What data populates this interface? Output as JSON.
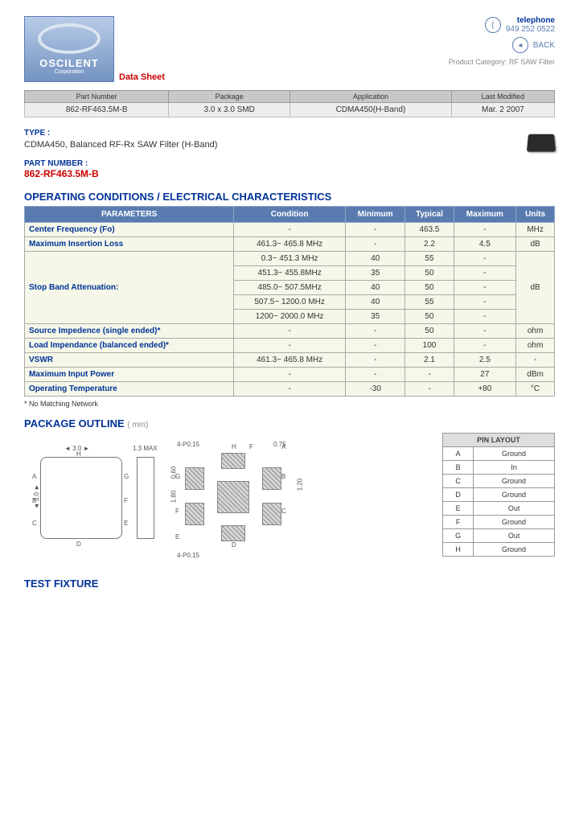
{
  "header": {
    "logo_name": "OSCILENT",
    "logo_sub": "Corporation",
    "datasheet_label": "Data Sheet",
    "telephone_label": "telephone",
    "telephone": "949 252 0522",
    "back": "BACK",
    "product_category_label": "Product Category:",
    "product_category": "RF SAW Filter"
  },
  "info": {
    "headers": [
      "Part Number",
      "Package",
      "Application",
      "Last Modified"
    ],
    "values": [
      "862-RF463.5M-B",
      "3.0 x 3.0 SMD",
      "CDMA450(H-Band)",
      "Mar. 2 2007"
    ]
  },
  "type_label": "TYPE :",
  "type_value": "CDMA450, Balanced RF-Rx SAW Filter (H-Band)",
  "pn_label": "PART NUMBER :",
  "pn_value": "862-RF463.5M-B",
  "char_heading": "OPERATING CONDITIONS / ELECTRICAL CHARACTERISTICS",
  "char_headers": [
    "PARAMETERS",
    "Condition",
    "Minimum",
    "Typical",
    "Maximum",
    "Units"
  ],
  "char_rows": [
    {
      "p": "Center Frequency (Fo)",
      "c": "-",
      "min": "-",
      "typ": "463.5",
      "max": "-",
      "u": "MHz",
      "rs": 1
    },
    {
      "p": "Maximum Insertion Loss",
      "c": "461.3~ 465.8 MHz",
      "min": "-",
      "typ": "2.2",
      "max": "4.5",
      "u": "dB",
      "rs": 1
    },
    {
      "p": "Stop Band Attenuation:",
      "c": "0.3~ 451.3 MHz",
      "min": "40",
      "typ": "55",
      "max": "-",
      "u": "dB",
      "rs": 5,
      "first": true
    },
    {
      "c": "451.3~ 455.8MHz",
      "min": "35",
      "typ": "50",
      "max": "-"
    },
    {
      "c": "485.0~ 507.5MHz",
      "min": "40",
      "typ": "50",
      "max": "-"
    },
    {
      "c": "507.5~ 1200.0 MHz",
      "min": "40",
      "typ": "55",
      "max": "-"
    },
    {
      "c": "1200~ 2000.0 MHz",
      "min": "35",
      "typ": "50",
      "max": "-"
    },
    {
      "p": "Source Impedence (single ended)*",
      "c": "-",
      "min": "-",
      "typ": "50",
      "max": "-",
      "u": "ohm",
      "rs": 1
    },
    {
      "p": "Load Impendance (balanced ended)*",
      "c": "-",
      "min": "-",
      "typ": "100",
      "max": "-",
      "u": "ohm",
      "rs": 1
    },
    {
      "p": "VSWR",
      "c": "461.3~ 465.8 MHz",
      "min": "-",
      "typ": "2.1",
      "max": "2.5",
      "u": "-",
      "rs": 1
    },
    {
      "p": "Maximum Input Power",
      "c": "-",
      "min": "-",
      "typ": "-",
      "max": "27",
      "u": "dBm",
      "rs": 1
    },
    {
      "p": "Operating Temperature",
      "c": "-",
      "min": "-30",
      "typ": "-",
      "max": "+80",
      "u": "°C",
      "rs": 1
    }
  ],
  "note": "* No Matching Network",
  "pkg_heading": "PACKAGE OUTLINE",
  "pkg_unit": "( mm)",
  "dims": {
    "w": "3.0",
    "h": "3.0",
    "t": "1.3 MAX",
    "pad1": "4-P0.15",
    "pad2": "4-P0.15",
    "d1": "0.75",
    "d2": "1.20",
    "d3": "1.80",
    "d4": "0.60"
  },
  "pin_heading": "PIN LAYOUT",
  "pins": [
    [
      "A",
      "Ground"
    ],
    [
      "B",
      "In"
    ],
    [
      "C",
      "Ground"
    ],
    [
      "D",
      "Ground"
    ],
    [
      "E",
      "Out"
    ],
    [
      "F",
      "Ground"
    ],
    [
      "G",
      "Out"
    ],
    [
      "H",
      "Ground"
    ]
  ],
  "test_heading": "TEST FIXTURE"
}
